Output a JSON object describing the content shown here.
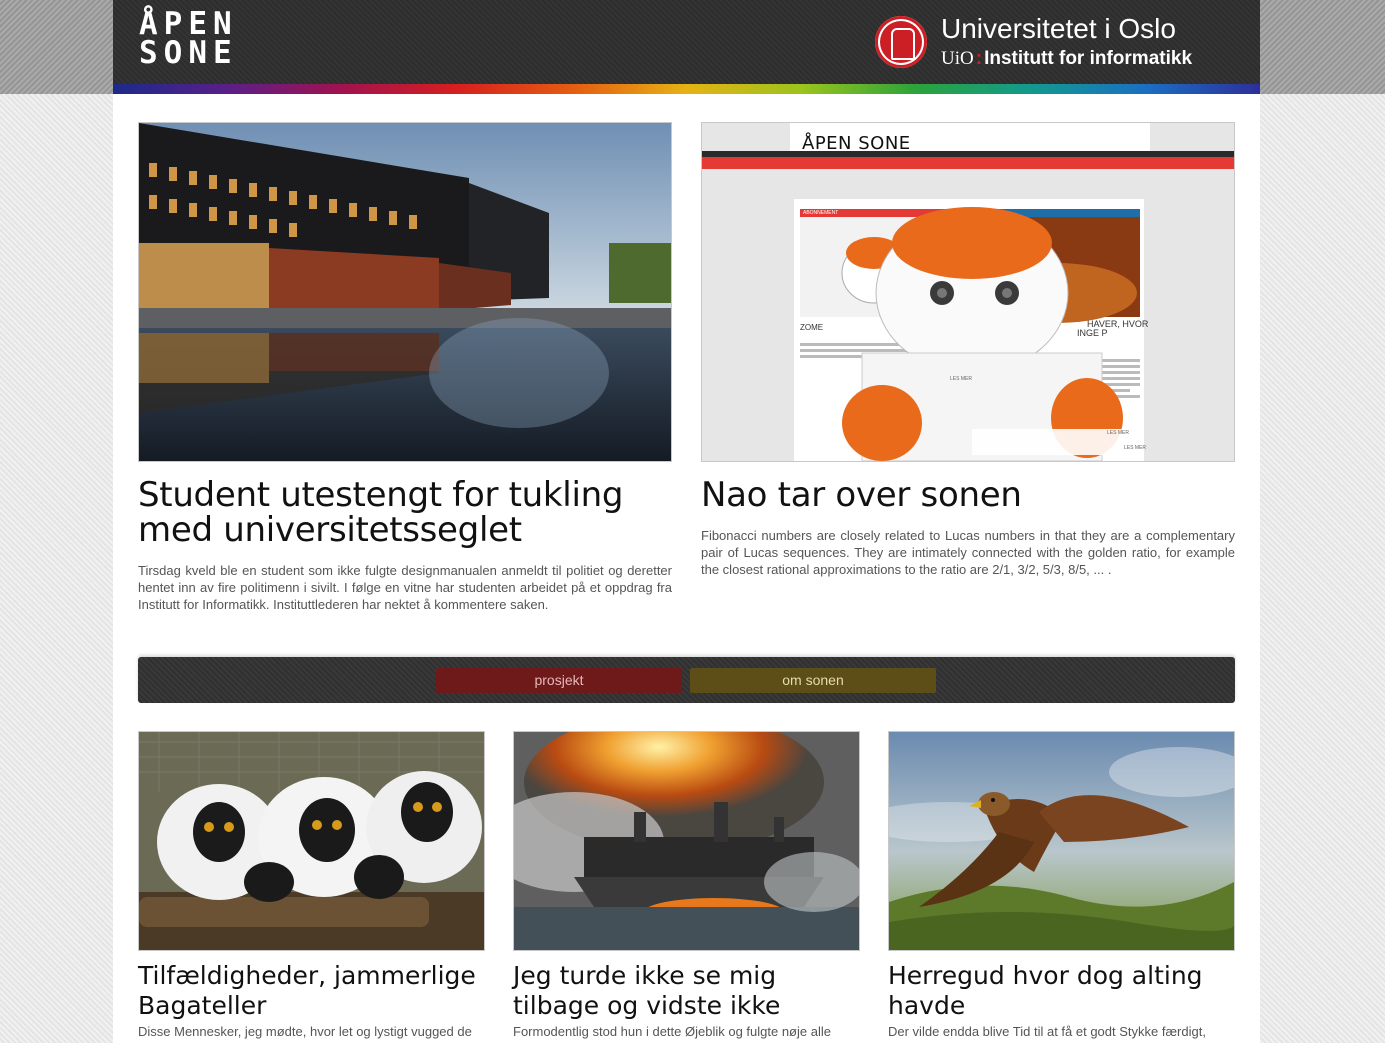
{
  "header": {
    "logo_line1": "ÅPEN",
    "logo_line2": "SONE",
    "university_name": "Universitetet i Oslo",
    "university_abbr": "UiO",
    "institute": "Institutt for informatikk"
  },
  "featured": [
    {
      "title": "Student utestengt for tukling med universitetsseglet",
      "text": "Tirsdag kveld ble en student som ikke fulgte designmanualen anmeldt til politiet og deretter hentet inn av fire politimenn i sivilt. I følge en vitne har studenten arbeidet på et oppdrag fra Institutt for Informatikk. Instituttlederen har nektet å kommentere saken."
    },
    {
      "title": "Nao tar over sonen",
      "text": "Fibonacci numbers are closely related to Lucas numbers in that they are a complementary pair of Lucas sequences. They are intimately connected with the golden ratio, for example the closest rational approximations to the ratio are 2/1, 3/2, 5/3, 8/5, ... .",
      "screenshot_header": "ÅPEN SONE",
      "screenshot_label": "ZOME",
      "screenshot_label2": "HAVER, HVOR",
      "screenshot_label3": "INGE P",
      "screenshot_more1": "LES MER",
      "screenshot_more2": "LES MER",
      "screenshot_more3": "LES MER",
      "screenshot_tag": "ABONNEMENT"
    }
  ],
  "nav": {
    "project": "prosjekt",
    "about": "om sonen"
  },
  "cards": [
    {
      "title": "Tilfældigheder, jammerlige Bagateller",
      "text": "Disse Mennesker, jeg mødte, hvor let og lystigt vugged de"
    },
    {
      "title": "Jeg turde ikke se mig tilbage og vidste ikke",
      "text": "Formodentlig stod hun i dette Øjeblik og fulgte nøje alle"
    },
    {
      "title": "Herregud hvor dog alting havde",
      "text": "Der vilde endda blive Tid til at få et godt Stykke færdigt,"
    }
  ]
}
